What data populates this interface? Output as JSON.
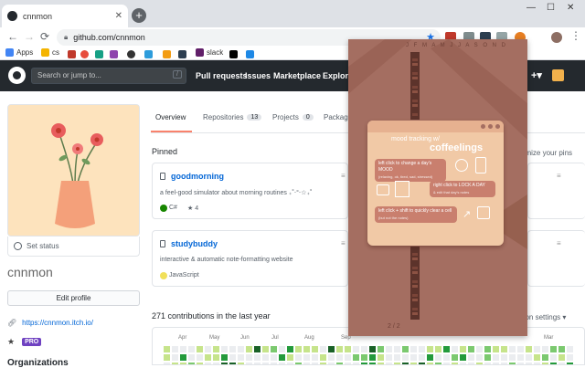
{
  "browser": {
    "tab_title": "cnnmon",
    "url": "github.com/cnnmon",
    "bookmarks": [
      {
        "label": "Apps",
        "color": "#4285f4"
      },
      {
        "label": "cs",
        "color": "#f4b400"
      },
      {
        "label": "slack",
        "color": "#611f69"
      }
    ],
    "ext_icons": [
      "#c0392b",
      "#7f8c8d",
      "#2c3e50",
      "#95a5a6",
      "#e67e22"
    ]
  },
  "github": {
    "search_placeholder": "Search or jump to...",
    "search_key": "/",
    "nav": [
      "Pull requests",
      "Issues",
      "Marketplace",
      "Explore"
    ],
    "plus": "+▾"
  },
  "profile": {
    "set_status": "Set status",
    "username": "cnnmon",
    "edit_profile": "Edit profile",
    "website": "https://cnnmon.itch.io/",
    "pro_badge": "PRO",
    "organizations": "Organizations"
  },
  "tabs": [
    {
      "label": "Overview"
    },
    {
      "label": "Repositories",
      "count": "13"
    },
    {
      "label": "Projects",
      "count": "0"
    },
    {
      "label": "Package"
    }
  ],
  "pinned": {
    "title": "Pinned",
    "customize": "omize your pins",
    "repos": [
      {
        "name": "goodmorning",
        "description": "a feel-good simulator about morning routines ₊˚‧°‧☆₊˚",
        "language": "C#",
        "lang_color": "#178600",
        "stars": "4"
      },
      {
        "name": "studybuddy",
        "description": "interactive & automatic note-formatting website",
        "language": "JavaScript",
        "lang_color": "#f1e05a"
      }
    ]
  },
  "contributions": {
    "title": "271 contributions in the last year",
    "settings": "ation settings ▾",
    "months": [
      "Apr",
      "May",
      "Jun",
      "Jul",
      "Aug",
      "Sep",
      "Mar"
    ]
  },
  "popup": {
    "months_header": "J F M A M J J A S O N D",
    "title_small": "mood tracking w/",
    "title_big": "coffeelings",
    "tips": [
      {
        "main": "left click to change a day's MOOD",
        "sub": "(relaxing, ok, tired, sad, stressed)"
      },
      {
        "main": "right click to LOCK A DAY",
        "sub": "& edit that day's notes"
      },
      {
        "main": "left click + shift to quickly clear a cell",
        "sub": "(but not the notes)"
      }
    ],
    "footer": "2 / 2"
  }
}
